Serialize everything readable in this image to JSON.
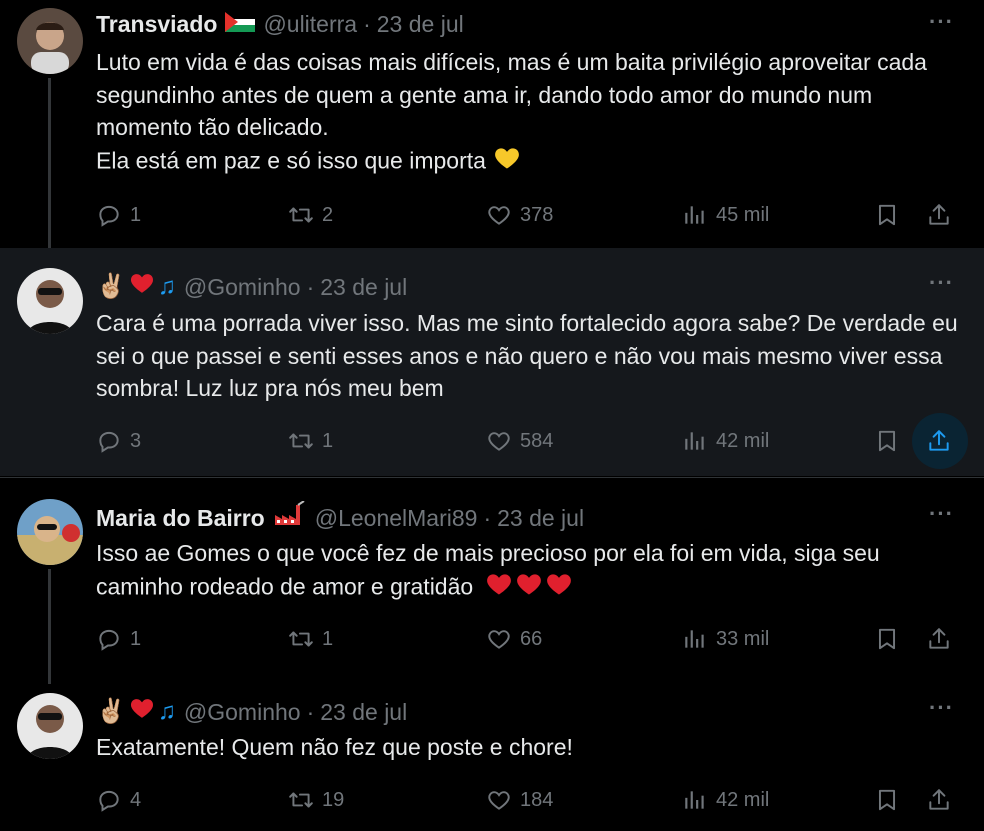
{
  "tweets": [
    {
      "name": "Transviado",
      "handle": "@uliterra",
      "date": "23 de jul",
      "text": "Luto em vida é das coisas mais difíceis, mas é um baita privilégio aproveitar cada segundinho antes de quem a gente ama ir, dando todo amor do mundo num momento tão delicado.",
      "text2": "Ela está em paz e só isso que importa",
      "replies": "1",
      "retweets": "2",
      "likes": "378",
      "views": "45 mil"
    },
    {
      "name": "",
      "handle": "@Gominho",
      "date": "23 de jul",
      "text": "Cara é uma porrada viver isso. Mas me sinto fortalecido agora sabe? De verdade eu sei o que passei e senti esses anos e não quero e não vou mais mesmo viver essa sombra! Luz luz pra nós meu bem",
      "replies": "3",
      "retweets": "1",
      "likes": "584",
      "views": "42 mil"
    },
    {
      "name": "Maria do Bairro",
      "handle": "@LeonelMari89",
      "date": "23 de jul",
      "text": "Isso ae Gomes o que você fez de mais precioso por ela foi em vida, siga seu caminho rodeado de amor e gratidão",
      "replies": "1",
      "retweets": "1",
      "likes": "66",
      "views": "33 mil"
    },
    {
      "name": "",
      "handle": "@Gominho",
      "date": "23 de jul",
      "text": "Exatamente! Quem não fez que poste e chore!",
      "replies": "4",
      "retweets": "19",
      "likes": "184",
      "views": "42 mil"
    }
  ],
  "colors": {
    "background": "#000000",
    "text": "#e7e9ea",
    "muted": "#71767b",
    "heart": "#f91880",
    "accent": "#1d9bf0"
  },
  "icons": [
    "reply-icon",
    "retweet-icon",
    "like-icon",
    "views-icon",
    "bookmark-icon",
    "share-icon",
    "more-icon"
  ]
}
